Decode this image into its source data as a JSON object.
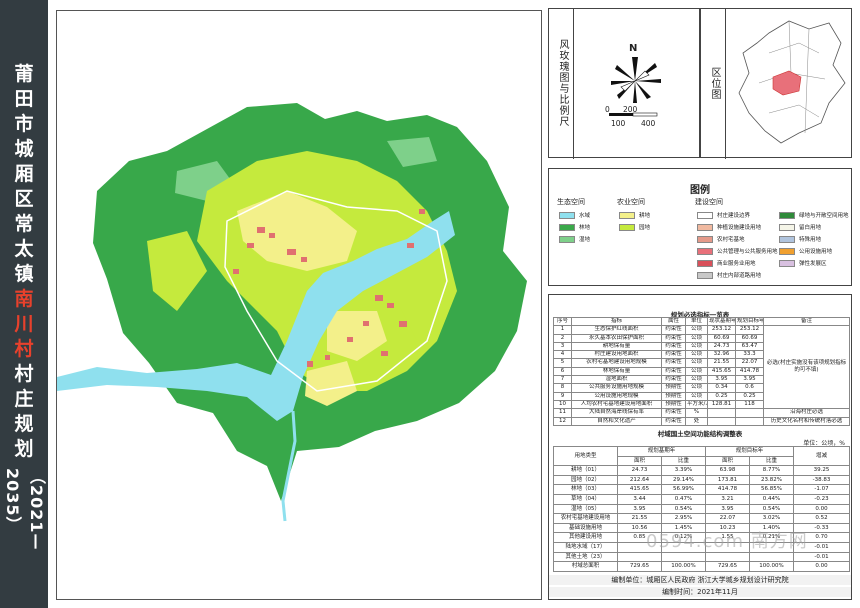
{
  "title": {
    "chars": [
      "莆",
      "田",
      "市",
      "城",
      "厢",
      "区",
      "常",
      "太",
      "镇",
      "南",
      "川",
      "村",
      "村",
      "庄",
      "规",
      "划"
    ],
    "highlight_index": [
      9,
      10,
      11
    ],
    "years": "（2021—2035）"
  },
  "compass": {
    "label": "风玫瑰图与比例尺",
    "north": "N",
    "scale_ticks": [
      "0",
      "200",
      "100",
      "400"
    ]
  },
  "location": {
    "label": "区位图"
  },
  "legend": {
    "title": "图例",
    "groups": [
      {
        "name": "生态空间",
        "items": [
          {
            "label": "水域",
            "color": "#8fe0ee"
          },
          {
            "label": "林地",
            "color": "#3aa94a"
          },
          {
            "label": "湿地",
            "color": "#7ed08a"
          }
        ]
      },
      {
        "name": "农业空间",
        "items": [
          {
            "label": "耕地",
            "color": "#f3f08a"
          },
          {
            "label": "园地",
            "color": "#c5ea3d"
          }
        ]
      },
      {
        "name": "建设空间",
        "items": [
          {
            "label": "村庄建设边界",
            "color": "#ffffff"
          },
          {
            "label": "种植设施建设用地",
            "color": "#f0b9a0"
          },
          {
            "label": "农村宅基地",
            "color": "#e59a8a"
          },
          {
            "label": "公共管理与公共服务用地",
            "color": "#e8707a"
          },
          {
            "label": "商业服务业用地",
            "color": "#d9505a"
          },
          {
            "label": "村庄内部道路用地",
            "color": "#c8c8c8"
          },
          {
            "label": "绿地与开敞空间用地",
            "color": "#2f8a3a"
          },
          {
            "label": "留白用地",
            "color": "#f5f5e8"
          },
          {
            "label": "特殊用地",
            "color": "#b0c4de"
          },
          {
            "label": "公用设施用地",
            "color": "#f0a030"
          },
          {
            "label": "弹性发展区",
            "color": "#d8c0e0"
          }
        ]
      }
    ]
  },
  "table1": {
    "title": "规划必选指标一览表",
    "headers": [
      "序号",
      "指标",
      "属性",
      "单位",
      "现状基期年",
      "规划目标年",
      "备注"
    ],
    "rows": [
      [
        "1",
        "生态保护红线面积",
        "约束性",
        "公顷",
        "253.12",
        "253.12",
        ""
      ],
      [
        "2",
        "永久基本农田保护面积",
        "约束性",
        "公顷",
        "60.69",
        "60.69",
        ""
      ],
      [
        "3",
        "耕地保有量",
        "约束性",
        "公顷",
        "24.73",
        "63.47",
        ""
      ],
      [
        "4",
        "村庄建设用地面积",
        "约束性",
        "公顷",
        "32.96",
        "33.3",
        ""
      ],
      [
        "5",
        "农村宅基地建设用地规模",
        "约束性",
        "公顷",
        "21.55",
        "22.07",
        ""
      ],
      [
        "6",
        "林地保有量",
        "约束性",
        "公顷",
        "415.65",
        "414.78",
        ""
      ],
      [
        "7",
        "湿地面积",
        "约束性",
        "公顷",
        "3.95",
        "3.95",
        ""
      ],
      [
        "8",
        "公共服务设施用地规模",
        "预期性",
        "公顷",
        "0.34",
        "0.6",
        ""
      ],
      [
        "9",
        "公用设施用地规模",
        "预期性",
        "公顷",
        "0.25",
        "0.25",
        ""
      ],
      [
        "10",
        "人均农村宅基地建设用地面积",
        "预期性",
        "平方米/人",
        "128.81",
        "118",
        ""
      ],
      [
        "11",
        "大陆自然海岸线保有率",
        "约束性",
        "%",
        "",
        "",
        "沿海村庄必选"
      ],
      [
        "12",
        "自然和文化遗产",
        "约束性",
        "处",
        "",
        "",
        "历史文化名村和传统村落必选"
      ]
    ],
    "remark_merged": "必选(村庄实施没有该项规划指标的可不填)"
  },
  "table2": {
    "title": "村域国土空间功能结构调整表",
    "unit": "单位：公顷，%",
    "col_type": "用地类型",
    "col_base": "规划基期年",
    "col_target": "规划目标年",
    "col_change": "增减",
    "sub_area": "面积",
    "sub_ratio": "比重",
    "rows": [
      [
        "耕地（01）",
        "24.73",
        "3.39%",
        "63.98",
        "8.77%",
        "39.25"
      ],
      [
        "园地（02）",
        "212.64",
        "29.14%",
        "173.81",
        "23.82%",
        "-38.83"
      ],
      [
        "林地（03）",
        "415.65",
        "56.99%",
        "414.78",
        "56.85%",
        "-1.07"
      ],
      [
        "草地（04）",
        "3.44",
        "0.47%",
        "3.21",
        "0.44%",
        "-0.23"
      ],
      [
        "湿地（05）",
        "3.95",
        "0.54%",
        "3.95",
        "0.54%",
        "0.00"
      ],
      [
        "农村宅基地建设用地",
        "21.55",
        "2.95%",
        "22.07",
        "3.02%",
        "0.52"
      ],
      [
        "基础设施用地",
        "10.56",
        "1.45%",
        "10.23",
        "1.40%",
        "-0.33"
      ],
      [
        "其他建设用地",
        "0.85",
        "0.12%",
        "1.55",
        "0.21%",
        "0.70"
      ],
      [
        "陆地水域（17）",
        "",
        "",
        "",
        "",
        "-0.01"
      ],
      [
        "其他土地（23）",
        "",
        "",
        "",
        "",
        "-0.01"
      ],
      [
        "村域总面积",
        "729.65",
        "100.00%",
        "729.65",
        "100.00%",
        "0.00"
      ]
    ]
  },
  "footer": {
    "unit_line": "编制单位：城厢区人民政府    浙江大学城乡规划设计研究院",
    "date_line": "编制时间：2021年11月"
  },
  "watermark": "0594.com 南方网"
}
